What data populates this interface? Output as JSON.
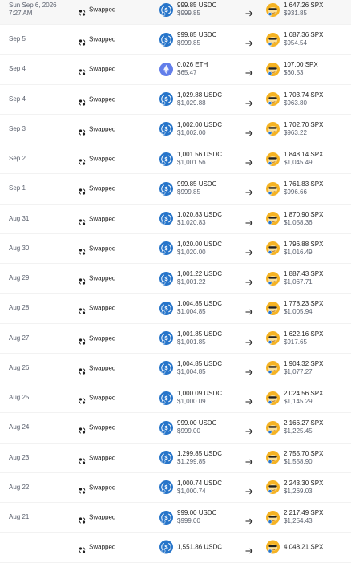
{
  "status_label": "Swapped",
  "colors": {
    "usdc": "#2775ca",
    "eth": "#627eea",
    "spx": "#f5b324",
    "muted": "#5b616e"
  },
  "transactions": [
    {
      "date": "Sun Sep 6, 2026\n7:27 AM",
      "from_asset": "USDC",
      "from_amount": "999.85 USDC",
      "from_usd": "$999.85",
      "to_amount": "1,647.26 SPX",
      "to_usd": "$931.85"
    },
    {
      "date": "Sep 5",
      "from_asset": "USDC",
      "from_amount": "999.85 USDC",
      "from_usd": "$999.85",
      "to_amount": "1,687.36 SPX",
      "to_usd": "$954.54"
    },
    {
      "date": "Sep 4",
      "from_asset": "ETH",
      "from_amount": "0.026 ETH",
      "from_usd": "$65.47",
      "to_amount": "107.00 SPX",
      "to_usd": "$60.53"
    },
    {
      "date": "Sep 4",
      "from_asset": "USDC",
      "from_amount": "1,029.88 USDC",
      "from_usd": "$1,029.88",
      "to_amount": "1,703.74 SPX",
      "to_usd": "$963.80"
    },
    {
      "date": "Sep 3",
      "from_asset": "USDC",
      "from_amount": "1,002.00 USDC",
      "from_usd": "$1,002.00",
      "to_amount": "1,702.70 SPX",
      "to_usd": "$963.22"
    },
    {
      "date": "Sep 2",
      "from_asset": "USDC",
      "from_amount": "1,001.56 USDC",
      "from_usd": "$1,001.56",
      "to_amount": "1,848.14 SPX",
      "to_usd": "$1,045.49"
    },
    {
      "date": "Sep 1",
      "from_asset": "USDC",
      "from_amount": "999.85 USDC",
      "from_usd": "$999.85",
      "to_amount": "1,761.83 SPX",
      "to_usd": "$996.66"
    },
    {
      "date": "Aug 31",
      "from_asset": "USDC",
      "from_amount": "1,020.83 USDC",
      "from_usd": "$1,020.83",
      "to_amount": "1,870.90 SPX",
      "to_usd": "$1,058.36"
    },
    {
      "date": "Aug 30",
      "from_asset": "USDC",
      "from_amount": "1,020.00 USDC",
      "from_usd": "$1,020.00",
      "to_amount": "1,796.88 SPX",
      "to_usd": "$1,016.49"
    },
    {
      "date": "Aug 29",
      "from_asset": "USDC",
      "from_amount": "1,001.22 USDC",
      "from_usd": "$1,001.22",
      "to_amount": "1,887.43 SPX",
      "to_usd": "$1,067.71"
    },
    {
      "date": "Aug 28",
      "from_asset": "USDC",
      "from_amount": "1,004.85 USDC",
      "from_usd": "$1,004.85",
      "to_amount": "1,778.23 SPX",
      "to_usd": "$1,005.94"
    },
    {
      "date": "Aug 27",
      "from_asset": "USDC",
      "from_amount": "1,001.85 USDC",
      "from_usd": "$1,001.85",
      "to_amount": "1,622.16 SPX",
      "to_usd": "$917.65"
    },
    {
      "date": "Aug 26",
      "from_asset": "USDC",
      "from_amount": "1,004.85 USDC",
      "from_usd": "$1,004.85",
      "to_amount": "1,904.32 SPX",
      "to_usd": "$1,077.27"
    },
    {
      "date": "Aug 25",
      "from_asset": "USDC",
      "from_amount": "1,000.09 USDC",
      "from_usd": "$1,000.09",
      "to_amount": "2,024.56 SPX",
      "to_usd": "$1,145.29"
    },
    {
      "date": "Aug 24",
      "from_asset": "USDC",
      "from_amount": "999.00 USDC",
      "from_usd": "$999.00",
      "to_amount": "2,166.27 SPX",
      "to_usd": "$1,225.45"
    },
    {
      "date": "Aug 23",
      "from_asset": "USDC",
      "from_amount": "1,299.85 USDC",
      "from_usd": "$1,299.85",
      "to_amount": "2,755.70 SPX",
      "to_usd": "$1,558.90"
    },
    {
      "date": "Aug 22",
      "from_asset": "USDC",
      "from_amount": "1,000.74 USDC",
      "from_usd": "$1,000.74",
      "to_amount": "2,243.30 SPX",
      "to_usd": "$1,269.03"
    },
    {
      "date": "Aug 21",
      "from_asset": "USDC",
      "from_amount": "999.00 USDC",
      "from_usd": "$999.00",
      "to_amount": "2,217.49 SPX",
      "to_usd": "$1,254.43"
    },
    {
      "date": "",
      "from_asset": "USDC",
      "from_amount": "1,551.86 USDC",
      "from_usd": "",
      "to_amount": "4,048.21 SPX",
      "to_usd": ""
    }
  ]
}
